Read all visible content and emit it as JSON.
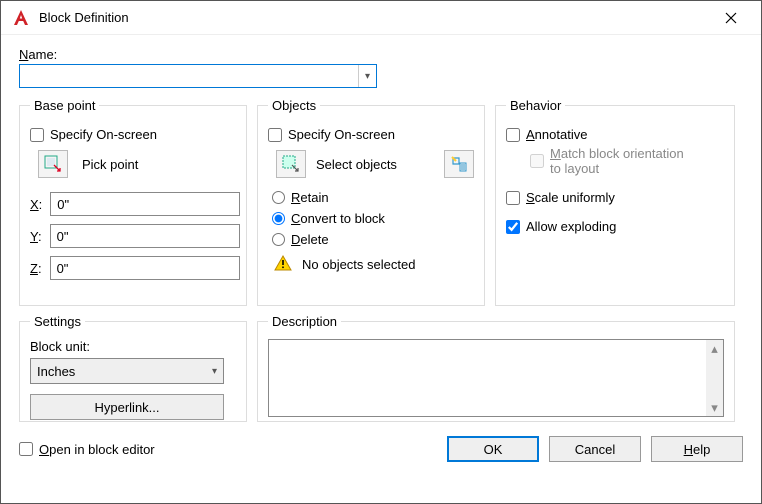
{
  "window": {
    "title": "Block Definition"
  },
  "name": {
    "label_pre": "N",
    "label_post": "ame:",
    "value": ""
  },
  "basepoint": {
    "legend": "Base point",
    "specify": "Specify On-screen",
    "pick": "Pick point",
    "x_label_pre": "X",
    "x_label_post": ":",
    "x_val": "0\"",
    "y_label_pre": "Y",
    "y_label_post": ":",
    "y_val": "0\"",
    "z_label_pre": "Z",
    "z_label_post": ":",
    "z_val": "0\""
  },
  "objects": {
    "legend": "Objects",
    "specify": "Specify On-screen",
    "select": "Select objects",
    "retain_pre": "R",
    "retain_post": "etain",
    "convert_pre": "C",
    "convert_post": "onvert to block",
    "delete_pre": "D",
    "delete_post": "elete",
    "warn": "No objects selected"
  },
  "behavior": {
    "legend": "Behavior",
    "annot_pre": "A",
    "annot_post": "nnotative",
    "match_pre": "M",
    "match1": "atch block orientation",
    "match2": "to layout",
    "scale_pre": "S",
    "scale_post": "cale uniformly",
    "explode_pre": "",
    "explode_post": "Allow exploding"
  },
  "settings": {
    "legend": "Settings",
    "blockunit_pre": "",
    "blockunit_post": "Block unit:",
    "unit_value": "Inches",
    "hyperlink": "Hyperlink..."
  },
  "description": {
    "legend": "Description",
    "value": ""
  },
  "footer": {
    "open_pre": "O",
    "open_post": "pen in block editor",
    "ok": "OK",
    "cancel": "Cancel",
    "help_pre": "H",
    "help_post": "elp"
  }
}
